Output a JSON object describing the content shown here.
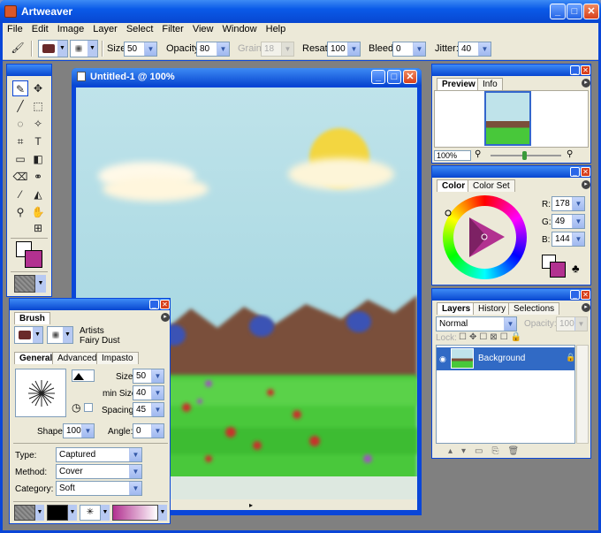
{
  "app": {
    "title": "Artweaver"
  },
  "menu": [
    "File",
    "Edit",
    "Image",
    "Layer",
    "Select",
    "Filter",
    "View",
    "Window",
    "Help"
  ],
  "toolbar": {
    "size_label": "Size:",
    "size_value": "50",
    "opacity_label": "Opacity:",
    "opacity_value": "80",
    "grain_label": "Grain:",
    "grain_value": "18",
    "resat_label": "Resat:",
    "resat_value": "100",
    "bleed_label": "Bleed:",
    "bleed_value": "0",
    "jitter_label": "Jitter:",
    "jitter_value": "40"
  },
  "document": {
    "title": "Untitled-1 @ 100%"
  },
  "preview_panel": {
    "tabs": [
      "Preview",
      "Info"
    ],
    "zoom": "100%"
  },
  "color_panel": {
    "tabs": [
      "Color",
      "Color Set"
    ],
    "r_label": "R:",
    "r": "178",
    "g_label": "G:",
    "g": "49",
    "b_label": "B:",
    "b": "144",
    "foreground": "#b23190",
    "background": "#ffffff"
  },
  "layers_panel": {
    "tabs": [
      "Layers",
      "History",
      "Selections"
    ],
    "blend_mode": "Normal",
    "opacity_label": "Opacity:",
    "opacity": "100",
    "lock_label": "Lock:",
    "layers": [
      {
        "name": "Background"
      }
    ]
  },
  "brush_panel": {
    "tab": "Brush",
    "category_name": "Artists",
    "variant_name": "Fairy Dust",
    "subtabs": [
      "General",
      "Advanced",
      "Impasto"
    ],
    "size_label": "Size:",
    "size": "50",
    "min_size_label": "min Size:",
    "min_size": "40",
    "spacing_label": "Spacing:",
    "spacing": "45",
    "shape_label": "Shape:",
    "shape": "100",
    "angle_label": "Angle:",
    "angle": "0",
    "type_label": "Type:",
    "type": "Captured",
    "method_label": "Method:",
    "method": "Cover",
    "category_label": "Category:",
    "category": "Soft"
  },
  "colors": {
    "accent": "#0a46d8",
    "panel_bg": "#ece9d8"
  }
}
